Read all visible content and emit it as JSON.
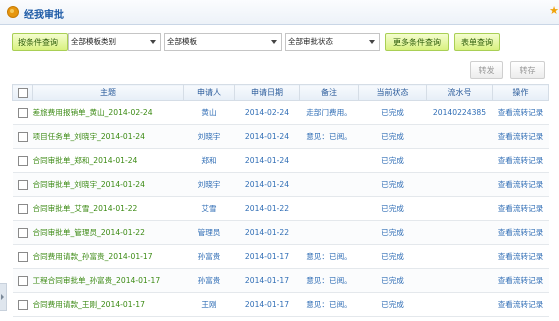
{
  "header": {
    "title": "经我审批"
  },
  "filters": {
    "query_by_condition": "按条件查询",
    "template_category": "全部模板类别",
    "template": "全部模板",
    "approval_status": "全部审批状态",
    "more_conditions": "更多条件查询",
    "form_query": "表单查询"
  },
  "actions": {
    "forward": "转发",
    "archive": "转存"
  },
  "table": {
    "headers": {
      "subject": "主题",
      "applicant": "申请人",
      "apply_date": "申请日期",
      "remark": "备注",
      "status": "当前状态",
      "serial": "流水号",
      "operation": "操作"
    },
    "rows": [
      {
        "subject": "差旅费用报销单_黄山_2014-02-24",
        "applicant": "黄山",
        "date": "2014-02-24",
        "remark": "走部门费用。",
        "status": "已完成",
        "serial": "20140224385",
        "op": "查看流转记录"
      },
      {
        "subject": "项目任务单_刘晓宇_2014-01-24",
        "applicant": "刘晓宇",
        "date": "2014-01-24",
        "remark": "意见：已阅。",
        "status": "已完成",
        "serial": "",
        "op": "查看流转记录"
      },
      {
        "subject": "合同审批单_郑和_2014-01-24",
        "applicant": "郑和",
        "date": "2014-01-24",
        "remark": "",
        "status": "已完成",
        "serial": "",
        "op": "查看流转记录"
      },
      {
        "subject": "合同审批单_刘晓宇_2014-01-24",
        "applicant": "刘晓宇",
        "date": "2014-01-24",
        "remark": "",
        "status": "已完成",
        "serial": "",
        "op": "查看流转记录"
      },
      {
        "subject": "合同审批单_艾雪_2014-01-22",
        "applicant": "艾雪",
        "date": "2014-01-22",
        "remark": "",
        "status": "已完成",
        "serial": "",
        "op": "查看流转记录"
      },
      {
        "subject": "合同审批单_管理员_2014-01-22",
        "applicant": "管理员",
        "date": "2014-01-22",
        "remark": "",
        "status": "已完成",
        "serial": "",
        "op": "查看流转记录"
      },
      {
        "subject": "合同费用请款_孙富贵_2014-01-17",
        "applicant": "孙富贵",
        "date": "2014-01-17",
        "remark": "意见：已阅。",
        "status": "已完成",
        "serial": "",
        "op": "查看流转记录"
      },
      {
        "subject": "工程合同审批单_孙富贵_2014-01-17",
        "applicant": "孙富贵",
        "date": "2014-01-17",
        "remark": "意见：已阅。",
        "status": "已完成",
        "serial": "",
        "op": "查看流转记录"
      },
      {
        "subject": "合同费用请款_王刚_2014-01-17",
        "applicant": "王刚",
        "date": "2014-01-17",
        "remark": "意见：已阅。",
        "status": "已完成",
        "serial": "",
        "op": "查看流转记录"
      }
    ]
  }
}
